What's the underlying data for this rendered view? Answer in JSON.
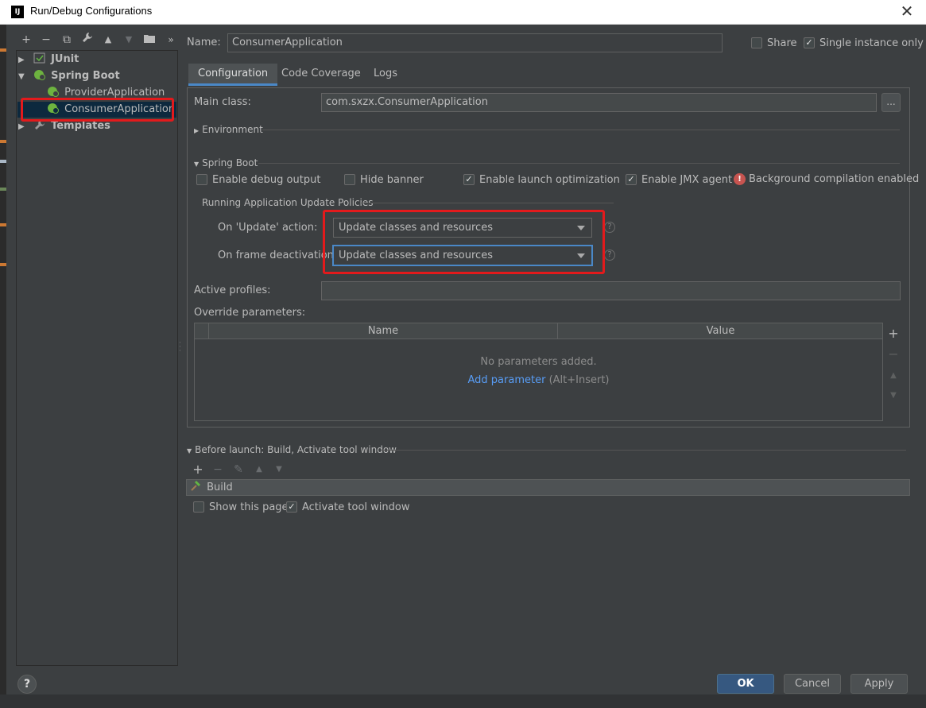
{
  "window": {
    "title": "Run/Debug Configurations",
    "app_icon": "intellij-icon",
    "close_icon": "close-icon",
    "close_glyph": "✕"
  },
  "left_toolbar": {
    "icons": [
      "add-icon",
      "remove-icon",
      "copy-icon",
      "wrench-icon",
      "move-up-icon",
      "move-down-icon",
      "folder-icon",
      "more-icon"
    ],
    "glyphs": [
      "+",
      "−",
      "⧉",
      "🔧",
      "▲",
      "▼",
      "📁",
      "»"
    ]
  },
  "tree": {
    "junit": "JUnit",
    "spring_boot": "Spring Boot",
    "provider": "ProviderApplication",
    "consumer": "ConsumerApplication",
    "templates": "Templates"
  },
  "name": {
    "label": "Name:",
    "value": "ConsumerApplication"
  },
  "share": {
    "label": "Share",
    "checked": false
  },
  "single_instance": {
    "label": "Single instance only",
    "checked": true
  },
  "tabs": [
    "Configuration",
    "Code Coverage",
    "Logs"
  ],
  "active_tab": "Configuration",
  "main_class": {
    "label": "Main class:",
    "value": "com.sxzx.ConsumerApplication",
    "browse_label": "..."
  },
  "environment": {
    "label": "Environment"
  },
  "spring_boot_section": {
    "label": "Spring Boot",
    "enable_debug_output": {
      "label": "Enable debug output",
      "checked": false
    },
    "hide_banner": {
      "label": "Hide banner",
      "checked": false
    },
    "enable_launch_optimization": {
      "label": "Enable launch optimization",
      "checked": true
    },
    "enable_jmx_agent": {
      "label": "Enable JMX agent",
      "checked": true
    },
    "bg_compilation": {
      "label": "Background compilation enabled",
      "icon": "error-icon"
    }
  },
  "update_policies": {
    "title": "Running Application Update Policies",
    "on_update_label": "On 'Update' action:",
    "on_update_value": "Update classes and resources",
    "on_frame_label": "On frame deactivation:",
    "on_frame_value": "Update classes and resources",
    "help_glyph": "?"
  },
  "active_profiles": {
    "label": "Active profiles:",
    "value": ""
  },
  "override_parameters": {
    "label": "Override parameters:",
    "columns": [
      "Name",
      "Value"
    ],
    "empty_text": "No parameters added.",
    "add_link": "Add parameter",
    "add_shortcut": "(Alt+Insert)",
    "side_glyphs": [
      "+",
      "−",
      "▲",
      "▼"
    ]
  },
  "before_launch": {
    "label": "Before launch: Build, Activate tool window",
    "toolbar_glyphs": [
      "+",
      "−",
      "✎",
      "▲",
      "▼"
    ],
    "build_item": "Build",
    "show_page": {
      "label": "Show this page",
      "checked": false
    },
    "activate_tool_window": {
      "label": "Activate tool window",
      "checked": true
    }
  },
  "buttons": {
    "ok": "OK",
    "cancel": "Cancel",
    "apply": "Apply",
    "help": "?"
  },
  "colors": {
    "accent": "#4a88c7",
    "highlight_box": "#e31a1c",
    "selection": "#0d293e",
    "link": "#589df6"
  }
}
